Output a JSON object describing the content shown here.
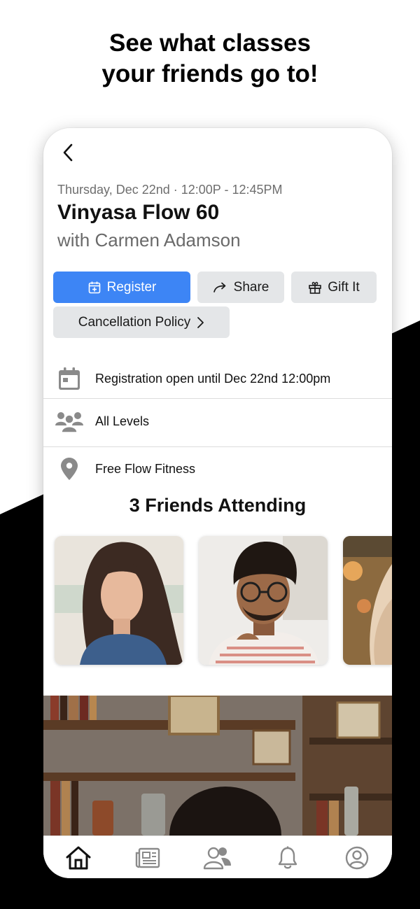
{
  "promo": {
    "line1": "See what classes",
    "line2": "your friends go to!"
  },
  "header": {
    "back_icon": "chevron-left-icon"
  },
  "class_info": {
    "datetime": "Thursday, Dec 22nd · 12:00P - 12:45PM",
    "title": "Vinyasa Flow 60",
    "instructor": "with Carmen Adamson"
  },
  "actions": {
    "register": "Register",
    "share": "Share",
    "gift": "Gift It",
    "cancellation": "Cancellation Policy"
  },
  "details": {
    "registration": "Registration open until Dec 22nd 12:00pm",
    "levels": "All Levels",
    "location": "Free Flow Fitness"
  },
  "friends": {
    "title": "3 Friends Attending"
  },
  "tabbar": {
    "items": [
      "home-icon",
      "news-icon",
      "friends-icon",
      "bell-icon",
      "profile-icon"
    ],
    "active": "home-icon"
  },
  "colors": {
    "accent": "#3D85F5",
    "secondary_button": "#E4E6E8",
    "icon_gray": "#8A8A8A"
  }
}
